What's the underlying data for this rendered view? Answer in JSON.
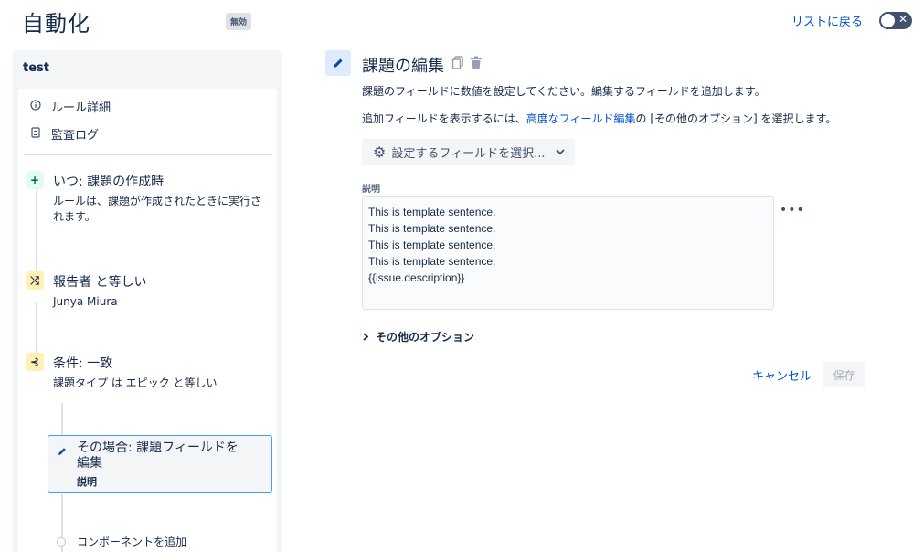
{
  "header": {
    "title": "自動化",
    "status": "無効",
    "back_link": "リストに戻る",
    "toggle_icon": "✕"
  },
  "sidebar": {
    "rule_name": "test",
    "nav": [
      {
        "label": "ルール詳細",
        "icon": "info-icon"
      },
      {
        "label": "監査ログ",
        "icon": "document-icon"
      }
    ],
    "steps": {
      "trigger": {
        "title": "いつ: 課題の作成時",
        "desc": "ルールは、課題が作成されたときに実行されます。",
        "icon": "+"
      },
      "condition": {
        "title": "報告者 と等しい",
        "desc": "Junya Miura",
        "icon": "⤮"
      },
      "branch": {
        "title": "条件: 一致",
        "desc": "課題タイプ は エピック と等しい",
        "icon": "⊰"
      },
      "action": {
        "title": "その場合: 課題フィールドを編集",
        "sub": "説明"
      }
    },
    "add_component": "コンポーネントを追加"
  },
  "main": {
    "title": "課題の編集",
    "description": "課題のフィールドに数値を設定してください。編集するフィールドを追加します。",
    "advanced_prefix": "追加フィールドを表示するには、",
    "advanced_link": "高度なフィールド編集",
    "advanced_suffix": "の [その他のオプション] を選択します。",
    "field_select_label": "設定するフィールドを選択...",
    "field_label": "説明",
    "field_value": "This is template sentence.\nThis is template sentence.\nThis is template sentence.\nThis is template sentence.\n{{issue.description}}",
    "more_options": "その他のオプション",
    "cancel": "キャンセル",
    "save": "保存"
  },
  "colors": {
    "link": "#0052cc",
    "text": "#172b4d",
    "selected_border": "#4c9aff"
  }
}
